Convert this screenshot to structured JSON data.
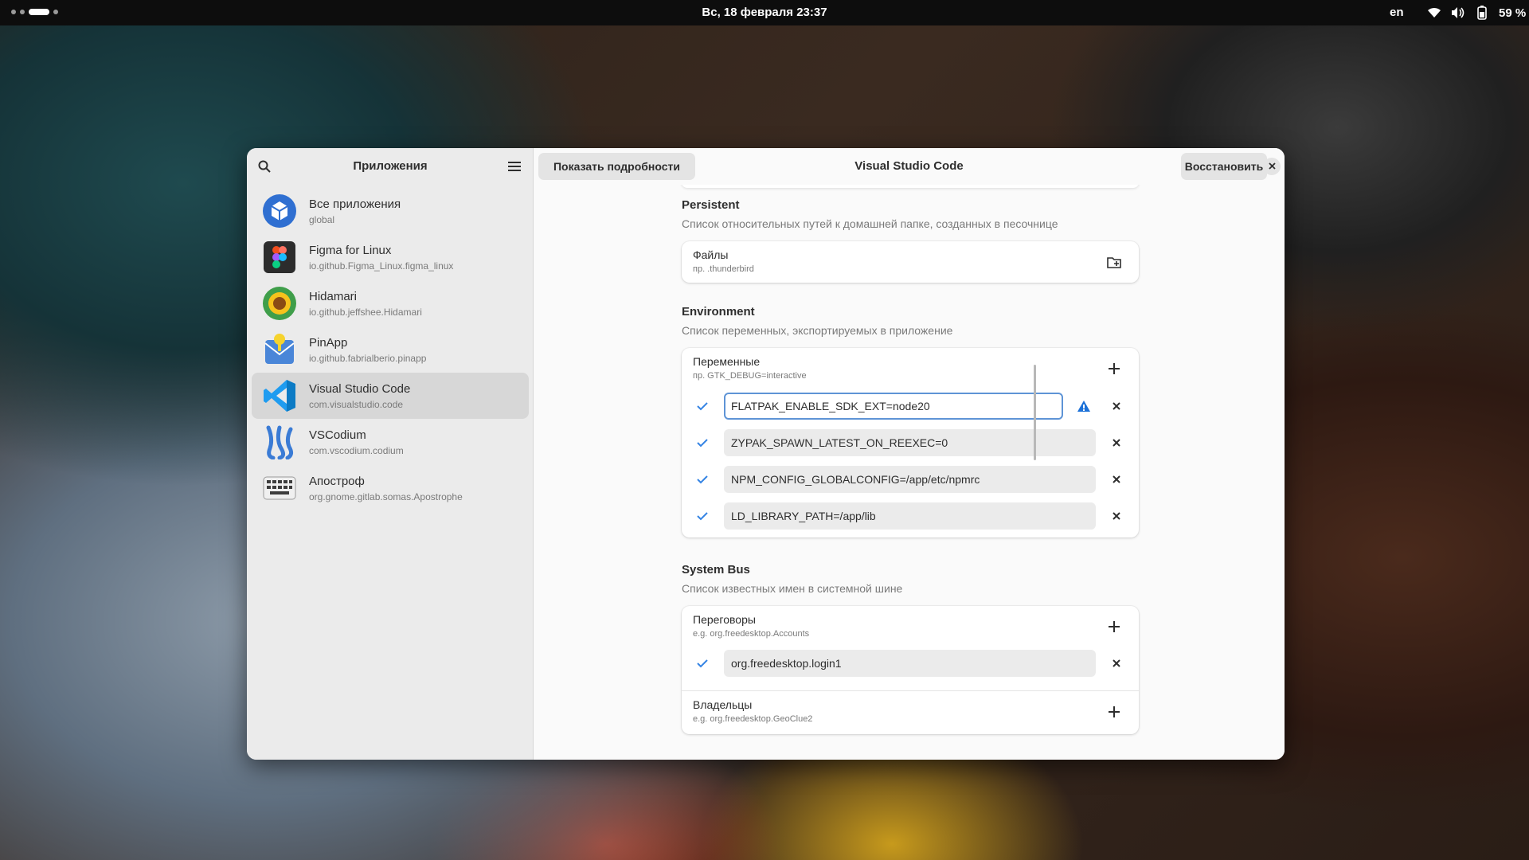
{
  "topbar": {
    "datetime": "Вс, 18 февраля  23:37",
    "language": "en",
    "battery": "59 %",
    "icons": [
      "wifi-icon",
      "volume-icon",
      "battery-icon"
    ]
  },
  "sidebar": {
    "title": "Приложения",
    "apps": [
      {
        "name": "Все приложения",
        "id": "global",
        "icon": "all-apps-icon"
      },
      {
        "name": "Figma for Linux",
        "id": "io.github.Figma_Linux.figma_linux",
        "icon": "figma-icon"
      },
      {
        "name": "Hidamari",
        "id": "io.github.jeffshee.Hidamari",
        "icon": "hidamari-icon"
      },
      {
        "name": "PinApp",
        "id": "io.github.fabrialberio.pinapp",
        "icon": "pinapp-icon"
      },
      {
        "name": "Visual Studio Code",
        "id": "com.visualstudio.code",
        "icon": "vscode-icon",
        "selected": true
      },
      {
        "name": "VSCodium",
        "id": "com.vscodium.codium",
        "icon": "vscodium-icon"
      },
      {
        "name": "Апостроф",
        "id": "org.gnome.gitlab.somas.Apostrophe",
        "icon": "apostrophe-icon"
      }
    ]
  },
  "header": {
    "show_details_label": "Показать подробности",
    "title": "Visual Studio Code",
    "restore_label": "Восстановить"
  },
  "persistent": {
    "title": "Persistent",
    "description": "Список относительных путей к домашней папке, созданных в песочнице",
    "row_title": "Файлы",
    "row_hint": "пр. .thunderbird"
  },
  "environment": {
    "title": "Environment",
    "description": "Список переменных, экспортируемых в приложение",
    "row_title": "Переменные",
    "row_hint": "пр. GTK_DEBUG=interactive",
    "variables": [
      "FLATPAK_ENABLE_SDK_EXT=node20",
      "ZYPAK_SPAWN_LATEST_ON_REEXEC=0",
      "NPM_CONFIG_GLOBALCONFIG=/app/etc/npmrc",
      "LD_LIBRARY_PATH=/app/lib"
    ]
  },
  "system_bus": {
    "title": "System Bus",
    "description": "Список известных имен в системной шине",
    "talk_title": "Переговоры",
    "talk_hint": "e.g. org.freedesktop.Accounts",
    "talk_names": [
      "org.freedesktop.login1"
    ],
    "own_title": "Владельцы",
    "own_hint": "e.g. org.freedesktop.GeoClue2"
  },
  "colors": {
    "accent": "#3584e4",
    "warning": "#1c71d8",
    "vscode": "#1f9cf0"
  }
}
